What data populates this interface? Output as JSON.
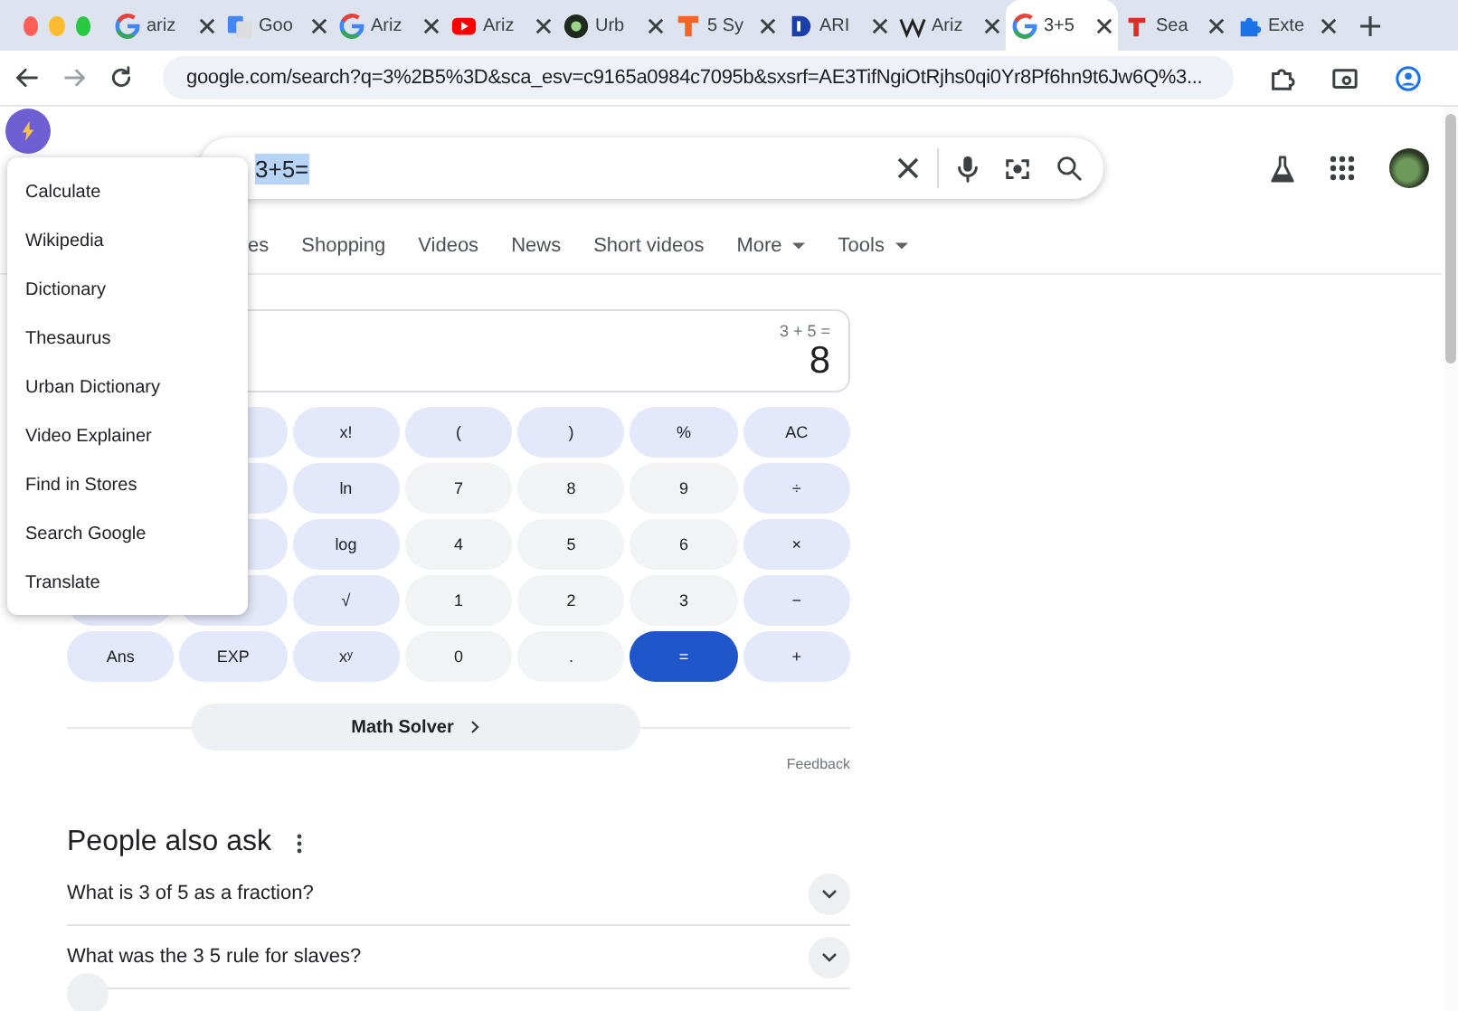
{
  "browser": {
    "tabs": [
      {
        "label": "ariz",
        "selected": false
      },
      {
        "label": "Goo",
        "selected": false
      },
      {
        "label": "Ariz",
        "selected": false
      },
      {
        "label": "Ariz",
        "selected": false
      },
      {
        "label": "Urb",
        "selected": false
      },
      {
        "label": "5 Sy",
        "selected": false
      },
      {
        "label": "ARI",
        "selected": false
      },
      {
        "label": "Ariz",
        "selected": false
      },
      {
        "label": "3+5",
        "selected": true
      },
      {
        "label": "Sea",
        "selected": false
      },
      {
        "label": "Exte",
        "selected": false
      }
    ],
    "address": "google.com/search?q=3%2B5%3D&sca_esv=c9165a0984c7095b&sxsrf=AE3TifNgiOtRjhs0qi0Yr8Pf6hn9t6Jw6Q%3..."
  },
  "extension_menu": {
    "items": [
      "Calculate",
      "Wikipedia",
      "Dictionary",
      "Thesaurus",
      "Urban Dictionary",
      "Video Explainer",
      "Find in Stores",
      "Search Google",
      "Translate"
    ]
  },
  "search": {
    "query": "3+5="
  },
  "nav_tabs": [
    {
      "label": "es",
      "dropdown": false
    },
    {
      "label": "Shopping",
      "dropdown": false
    },
    {
      "label": "Videos",
      "dropdown": false
    },
    {
      "label": "News",
      "dropdown": false
    },
    {
      "label": "Short videos",
      "dropdown": false
    },
    {
      "label": "More",
      "dropdown": true
    },
    {
      "label": "Tools",
      "dropdown": true
    }
  ],
  "calculator": {
    "expression": "3 + 5 =",
    "result": "8",
    "keys": [
      [
        {
          "kind": "covered"
        },
        {
          "kind": "function"
        },
        {
          "kind": "function",
          "label": "x!"
        },
        {
          "kind": "function",
          "label": "("
        },
        {
          "kind": "function",
          "label": ")"
        },
        {
          "kind": "function",
          "label": "%"
        },
        {
          "kind": "function",
          "label": "AC"
        }
      ],
      [
        {
          "kind": "covered"
        },
        {
          "kind": "function"
        },
        {
          "kind": "function",
          "label": "ln"
        },
        {
          "kind": "digit",
          "label": "7"
        },
        {
          "kind": "digit",
          "label": "8"
        },
        {
          "kind": "digit",
          "label": "9"
        },
        {
          "kind": "function",
          "label": "÷"
        }
      ],
      [
        {
          "kind": "covered"
        },
        {
          "kind": "function"
        },
        {
          "kind": "function",
          "label": "log"
        },
        {
          "kind": "digit",
          "label": "4"
        },
        {
          "kind": "digit",
          "label": "5"
        },
        {
          "kind": "digit",
          "label": "6"
        },
        {
          "kind": "function",
          "label": "×"
        }
      ],
      [
        {
          "kind": "function"
        },
        {
          "kind": "function"
        },
        {
          "kind": "function",
          "label": "√"
        },
        {
          "kind": "digit",
          "label": "1"
        },
        {
          "kind": "digit",
          "label": "2"
        },
        {
          "kind": "digit",
          "label": "3"
        },
        {
          "kind": "function",
          "label": "−"
        }
      ],
      [
        {
          "kind": "function",
          "label": "Ans"
        },
        {
          "kind": "function",
          "label": "EXP"
        },
        {
          "kind": "function",
          "label": "xʸ"
        },
        {
          "kind": "digit",
          "label": "0"
        },
        {
          "kind": "digit",
          "label": "."
        },
        {
          "kind": "equals",
          "label": "="
        },
        {
          "kind": "function",
          "label": "+"
        }
      ]
    ],
    "solver": "Math Solver",
    "feedback": "Feedback"
  },
  "people_also_ask": {
    "title": "People also ask",
    "questions": [
      "What is 3 of 5 as a fraction?",
      "What was the 3 5 rule for slaves?"
    ]
  }
}
